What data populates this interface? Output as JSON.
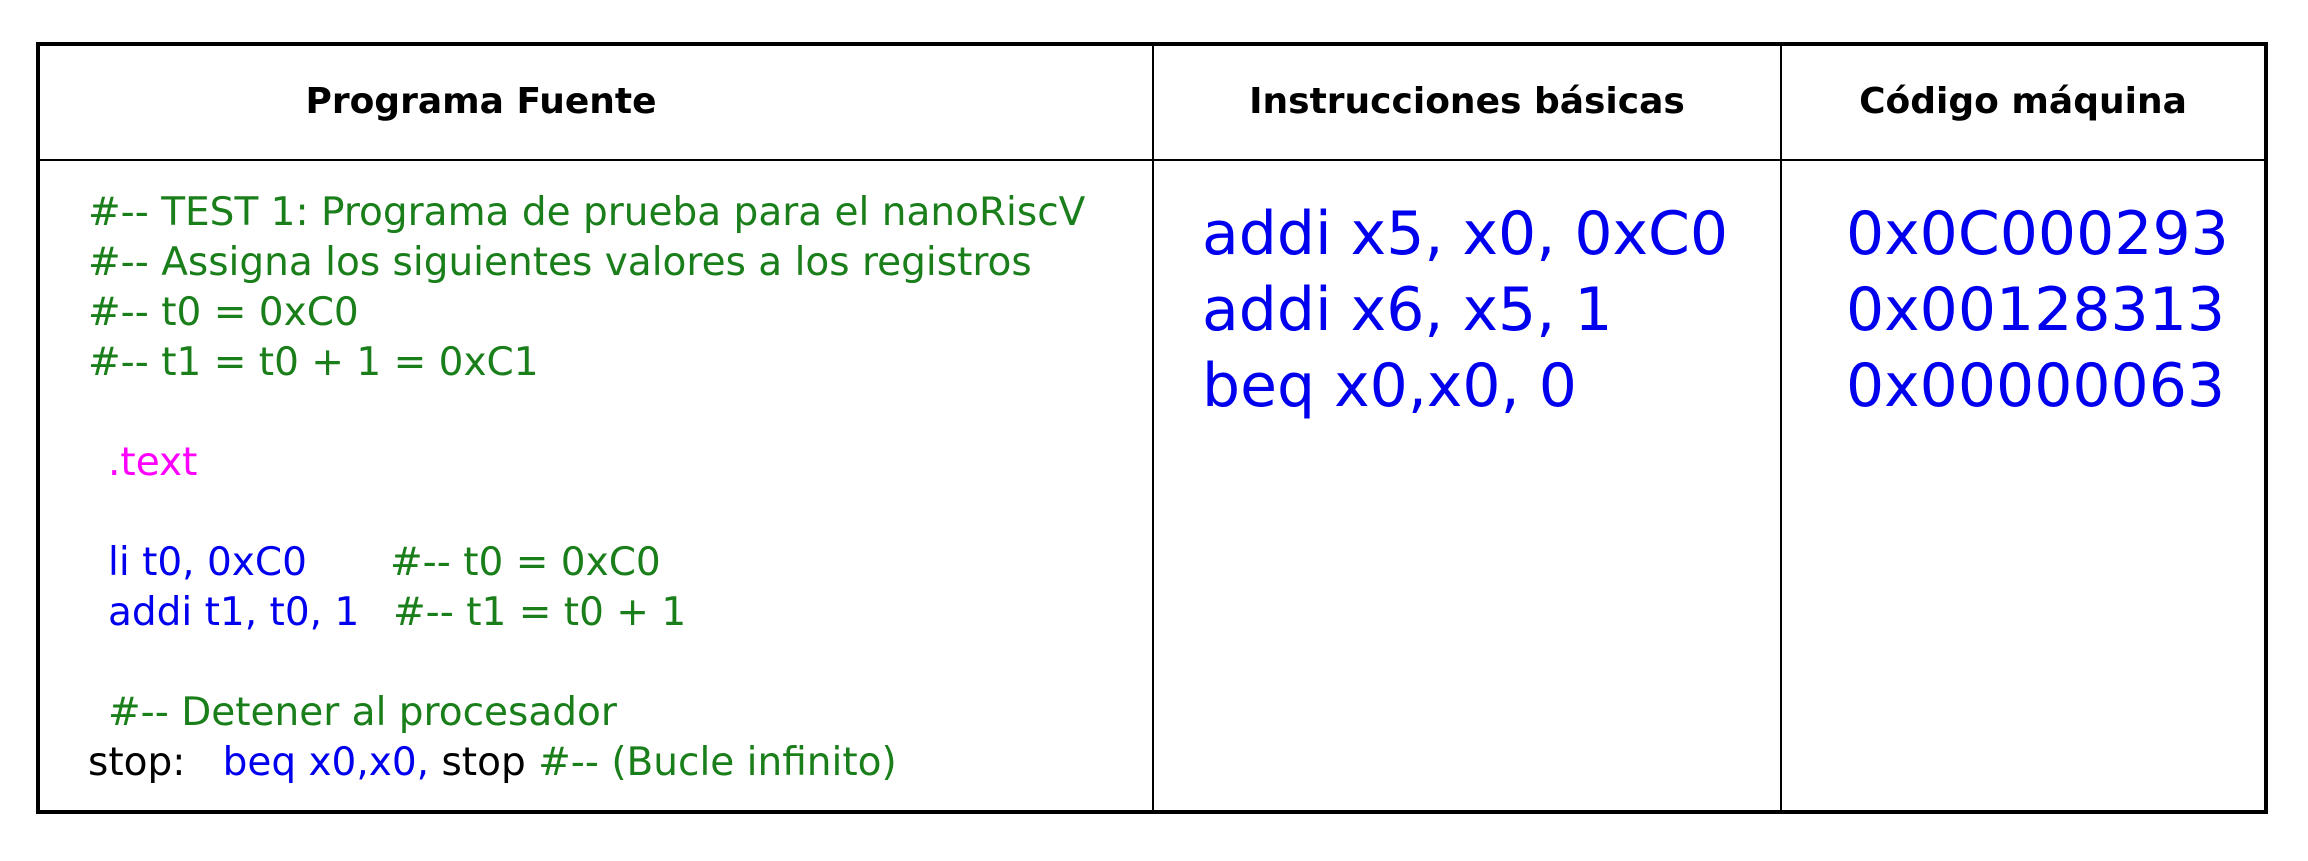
{
  "colors": {
    "comment": "#1a7f1a",
    "directive": "#ff00ff",
    "instruction": "#0000ee",
    "plain": "#000000"
  },
  "headers": {
    "source": "Programa Fuente",
    "basic": "Instrucciones básicas",
    "machine": "Código máquina"
  },
  "source": {
    "comment_1": "#-- TEST 1: Programa de prueba para el nanoRiscV",
    "comment_2": "#-- Assigna los siguientes valores a los registros",
    "comment_3": "#-- t0 = 0xC0",
    "comment_4": "#-- t1 = t0 + 1 = 0xC1",
    "directive": ".text",
    "line_li_instr": "li t0, 0xC0",
    "line_li_comment": "#-- t0 = 0xC0",
    "line_addi_instr": "addi t1, t0, 1",
    "line_addi_comment": "#-- t1 = t0 + 1",
    "comment_stop": "#-- Detener al procesador",
    "stop_label": "stop:",
    "stop_instr": "beq x0,x0,",
    "stop_target": "stop",
    "stop_comment": "#-- (Bucle infinito)"
  },
  "basic_instructions": [
    "addi x5, x0, 0xC0",
    "addi x6, x5, 1",
    "beq x0,x0, 0"
  ],
  "machine_code": [
    "0x0C000293",
    "0x00128313",
    "0x00000063"
  ]
}
